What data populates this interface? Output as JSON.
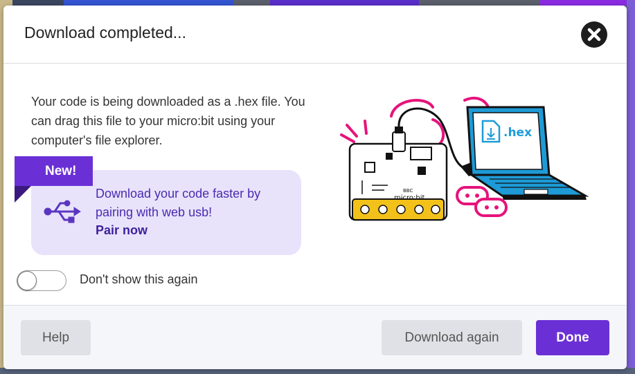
{
  "dialog": {
    "title": "Download completed...",
    "description": "Your code is being downloaded as a .hex file. You can drag this file to your micro:bit using your computer's file explorer.",
    "new_badge": "New!",
    "pair_text": "Download your code faster by pairing with web usb!",
    "pair_link": "Pair now",
    "toggle_label": "Don't show this again",
    "toggle_on": false,
    "illustration": {
      "file_label": ".hex",
      "board_label": "micro:bit",
      "board_brand": "BBC"
    }
  },
  "footer": {
    "help_label": "Help",
    "download_again_label": "Download again",
    "done_label": "Done"
  },
  "colors": {
    "accent": "#6a30d6",
    "pair_bg": "#e8e3fb",
    "laptop": "#1e9bd7",
    "illustration_pink": "#e6137b",
    "board_gold": "#f3c21a"
  },
  "icons": [
    "close-icon",
    "usb-icon"
  ]
}
